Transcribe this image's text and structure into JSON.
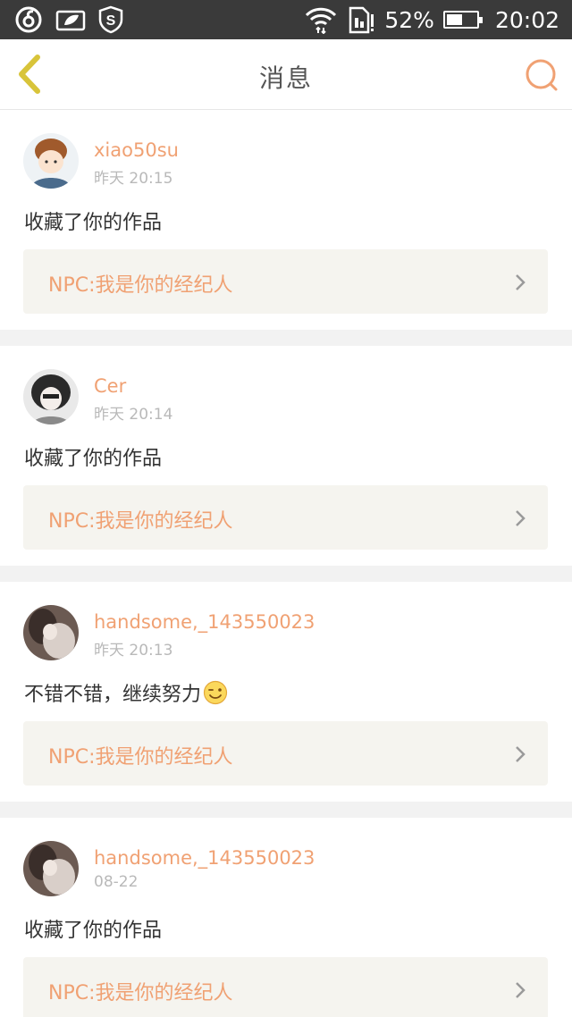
{
  "status_bar": {
    "battery_percent": "52%",
    "battery_level": 0.52,
    "time": "20:02",
    "icons": [
      "netease-music-icon",
      "leaf-card-icon",
      "shield-s-icon",
      "wifi-icon",
      "sim-alert-icon",
      "battery-icon"
    ]
  },
  "nav": {
    "title": "消息",
    "back_icon": "chevron-left-icon",
    "search_icon": "search-icon"
  },
  "colors": {
    "accent": "#f0a173",
    "back_icon": "#d8c43a",
    "text": "#333333",
    "muted": "#b9b9b9",
    "card_bg": "#f5f4ef"
  },
  "messages": [
    {
      "username": "xiao50su",
      "time": "昨天 20:15",
      "comment": "收藏了你的作品",
      "work_title": "NPC:我是你的经纪人"
    },
    {
      "username": "Cer",
      "time": "昨天 20:14",
      "comment": "收藏了你的作品",
      "work_title": "NPC:我是你的经纪人"
    },
    {
      "username": "handsome,_143550023",
      "time": "昨天 20:13",
      "comment": "不错不错，继续努力",
      "emoji": "smile-wink-icon",
      "work_title": "NPC:我是你的经纪人"
    },
    {
      "username": "handsome,_143550023",
      "time": "08-22",
      "comment": "收藏了你的作品",
      "work_title": "NPC:我是你的经纪人"
    }
  ]
}
